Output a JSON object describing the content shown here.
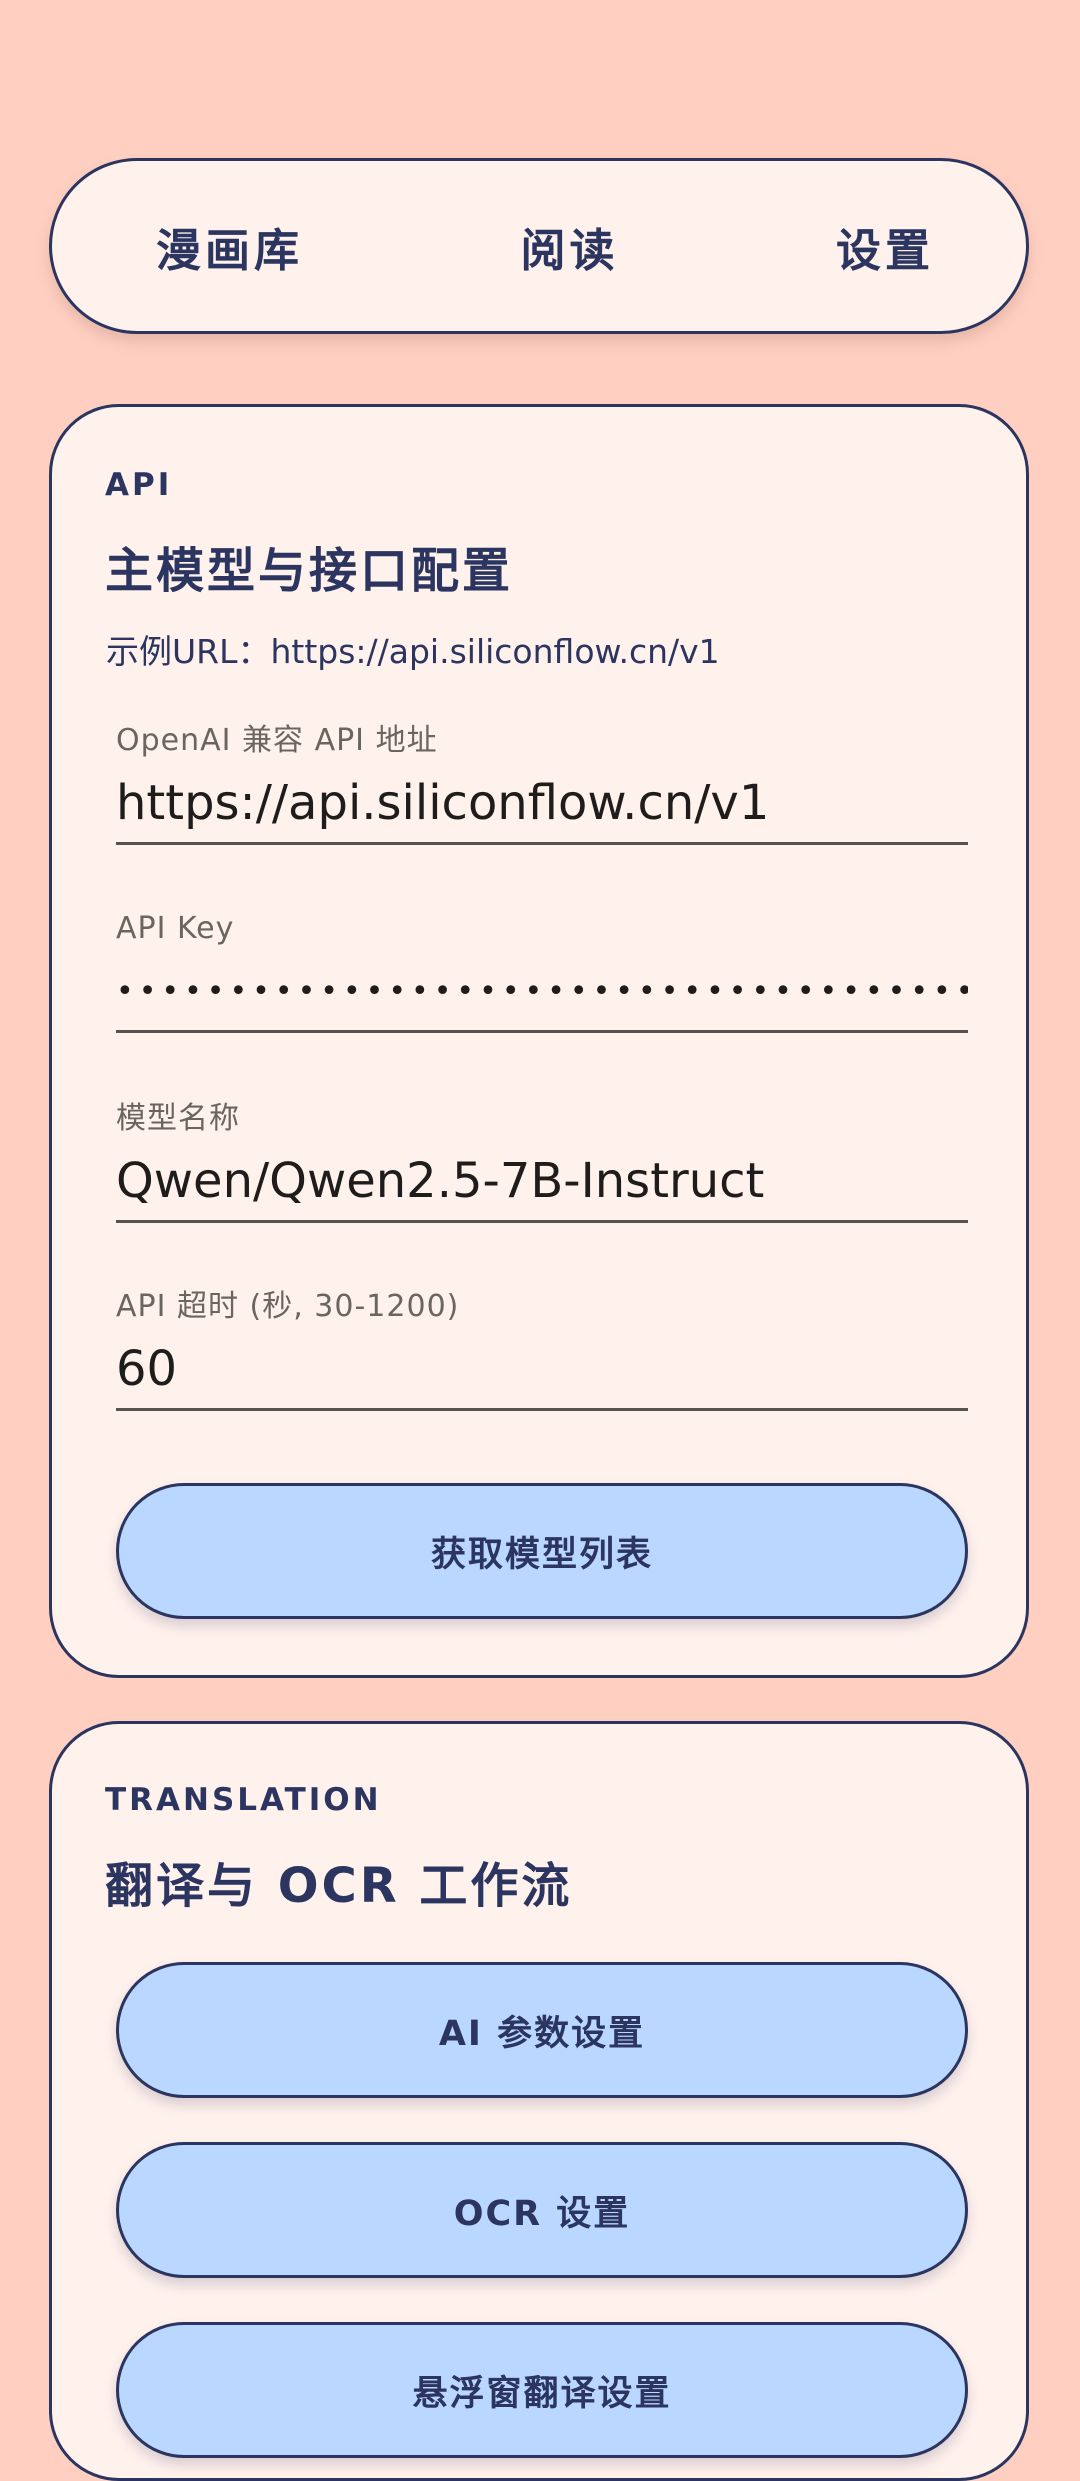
{
  "tabs": [
    {
      "label": "漫画库"
    },
    {
      "label": "阅读"
    },
    {
      "label": "设置"
    }
  ],
  "api_card": {
    "eyebrow": "API",
    "title": "主模型与接口配置",
    "example_url": "示例URL：https://api.siliconflow.cn/v1",
    "fields": {
      "base_url": {
        "label": "OpenAI 兼容 API 地址",
        "value": "https://api.siliconflow.cn/v1"
      },
      "api_key": {
        "label": "API Key",
        "value": "••••••••••••••••••••••••••••••••••••••••••••••••"
      },
      "model_name": {
        "label": "模型名称",
        "value": "Qwen/Qwen2.5-7B-Instruct"
      },
      "timeout": {
        "label": "API 超时 (秒, 30-1200)",
        "value": "60"
      }
    },
    "fetch_models_button": "获取模型列表"
  },
  "translation_card": {
    "eyebrow": "TRANSLATION",
    "title": "翻译与 OCR 工作流",
    "buttons": {
      "ai_params": "AI 参数设置",
      "ocr": "OCR 设置",
      "floating_window": "悬浮窗翻译设置"
    }
  },
  "colors": {
    "background": "#FFD0C2",
    "card": "#FFF1EC",
    "ink": "#2B3560",
    "button": "#B9D7FF"
  }
}
